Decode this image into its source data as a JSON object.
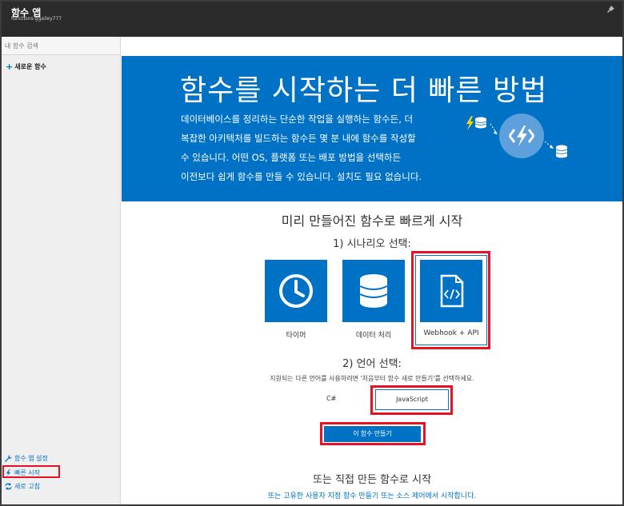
{
  "header": {
    "title": "함수 앱",
    "subtitle": "functions-ggailey777"
  },
  "sidebar": {
    "search_placeholder": "내 함수 검색",
    "new_function": "새로운 함수",
    "bottom_items": [
      {
        "label": "함수 앱 설정",
        "icon": "wrench-icon"
      },
      {
        "label": "빠른 시작",
        "icon": "lightning-icon"
      },
      {
        "label": "새로 고침",
        "icon": "refresh-icon"
      }
    ]
  },
  "hero": {
    "title": "함수를 시작하는 더 빠른 방법",
    "lines": [
      "데이터베이스를 정리하는 단순한 작업을 실행하는 함수든, 더",
      "복잡한 아키텍처를 빌드하는 함수든 몇 분 내에 함수를 작성할",
      "수 있습니다. 어떤 OS, 플랫폼 또는 배포 방법을 선택하든",
      "이전보다 쉽게 함수를 만들 수 있습니다. 설치도 필요 없습니다."
    ]
  },
  "quickstart": {
    "title": "미리 만들어진 함수로 빠르게 시작",
    "step1": "1) 시나리오 선택:",
    "scenarios": [
      {
        "label": "타이머",
        "icon": "clock-icon"
      },
      {
        "label": "데이터 처리",
        "icon": "database-icon"
      },
      {
        "label": "Webhook + API",
        "icon": "code-file-icon"
      }
    ],
    "step2": "2) 언어 선택:",
    "lang_note": "지원되는 다른 언어를 사용하려면 '처음부터 함수 새로 만들기'를 선택하세요.",
    "languages": [
      "C#",
      "JavaScript"
    ],
    "create_button": "이 함수 만들기"
  },
  "custom": {
    "title": "또는 직접 만든 함수로 시작",
    "link": "또는 고유한 사용자 지정 함수 만들기 또는 소스 제어에서 시작합니다."
  },
  "colors": {
    "accent": "#0072c6",
    "highlight": "#e81123",
    "titlebar": "#2b2b2b"
  }
}
